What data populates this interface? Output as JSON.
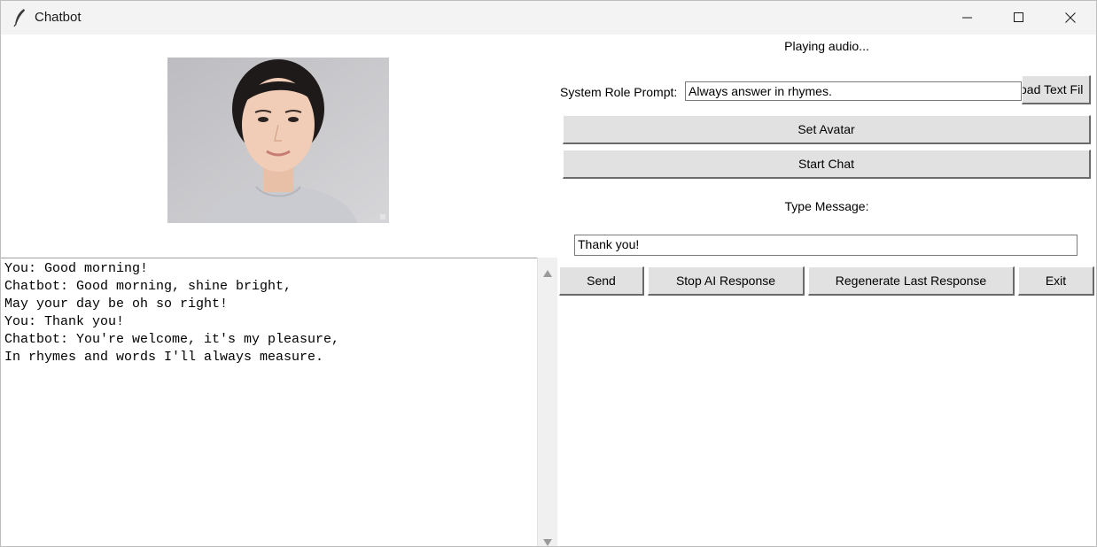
{
  "window": {
    "title": "Chatbot",
    "app_icon": "feather-icon",
    "controls": [
      "minimize-icon",
      "maximize-icon",
      "close-icon"
    ]
  },
  "status": "Playing audio...",
  "system_prompt": {
    "label": "System Role Prompt:",
    "value": "Always answer in rhymes.",
    "load_button": "oad Text Fil"
  },
  "buttons": {
    "set_avatar": "Set Avatar",
    "start_chat": "Start Chat",
    "send": "Send",
    "stop": "Stop AI Response",
    "regenerate": "Regenerate Last Response",
    "exit": "Exit"
  },
  "message": {
    "label": "Type Message:",
    "value": "Thank you!"
  },
  "chat_log": [
    "You: Good morning!",
    "Chatbot: Good morning, shine bright,",
    "May your day be oh so right!",
    "You: Thank you!",
    "Chatbot: You're welcome, it's my pleasure,",
    "In rhymes and words I'll always measure."
  ]
}
